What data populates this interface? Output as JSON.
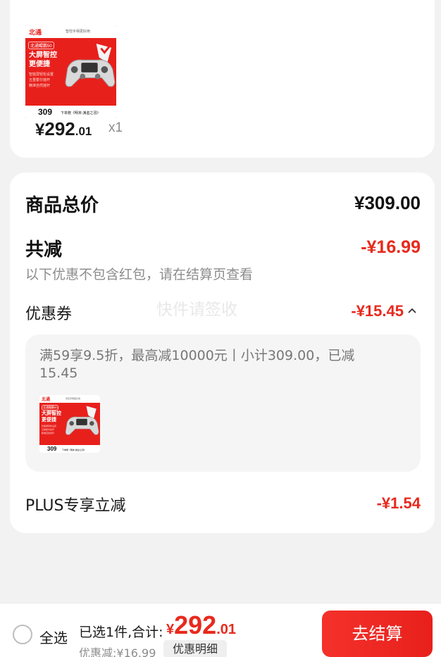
{
  "product": {
    "thumbnail": {
      "brand": "北通",
      "subtitle": "智控手柄更好用",
      "tag": "北通鲲鹏50",
      "headline_line1": "大屏智控",
      "headline_line2": "更便捷",
      "features": [
        "智能屏轻松设置",
        "五重霍尔摇杆",
        "精准自然摇杆"
      ],
      "bottom_price": "309",
      "bottom_note": "下单赠《明末:渊虚之羽》"
    },
    "price_symbol": "¥",
    "price_integer": "292",
    "price_decimal": ".01",
    "quantity": "x1"
  },
  "summary": {
    "total_label": "商品总价",
    "total_value": "¥309.00",
    "reduce_label": "共减",
    "reduce_value": "-¥16.99",
    "reduce_note": "以下优惠不包含红包，请在结算页查看",
    "coupon_label": "优惠券",
    "coupon_value": "-¥15.45",
    "coupon_desc": "满59享9.5折，最高减10000元丨小计309.00，已减15.45",
    "plus_label": "PLUS专享立减",
    "plus_value": "-¥1.54"
  },
  "watermark": "快件请签收",
  "bottom_bar": {
    "select_all": "全选",
    "selected_text": "已选1件,合计:",
    "sum_symbol": "¥",
    "sum_integer": "292",
    "sum_decimal": ".01",
    "discount_text": "优惠减:¥16.99",
    "detail_button": "优惠明细",
    "checkout_button": "去结算"
  },
  "colors": {
    "accent": "#e8291c",
    "background": "#f2f2f2",
    "card": "#ffffff"
  },
  "icons": {
    "coupon_toggle": "chevron-up-icon",
    "select_all": "radio-unchecked-icon"
  }
}
